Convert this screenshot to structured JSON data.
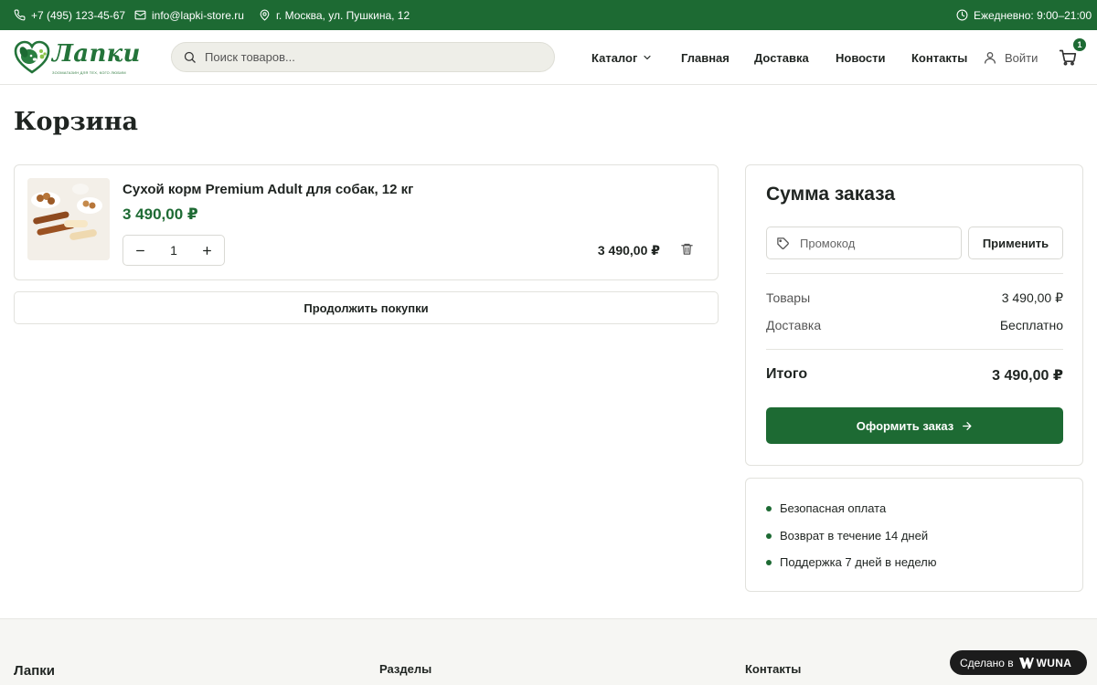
{
  "topbar": {
    "phone": "+7 (495) 123-45-67",
    "email": "info@lapki-store.ru",
    "address": "г. Москва, ул. Пушкина, 12",
    "hours": "Ежедневно: 9:00–21:00"
  },
  "header": {
    "logo_text": "Лапки",
    "logo_tagline": "ЗООМАГАЗИН ДЛЯ ТЕХ, КОГО ЛЮБИМ",
    "search_placeholder": "Поиск товаров...",
    "nav": [
      "Каталог",
      "Главная",
      "Доставка",
      "Новости",
      "Контакты"
    ],
    "login": "Войти",
    "cart_count": "1"
  },
  "page": {
    "title": "Корзина"
  },
  "cart": {
    "items": [
      {
        "name": "Сухой корм Premium Adult для собак, 12 кг",
        "price": "3 490,00 ₽",
        "quantity": "1",
        "line_total": "3 490,00 ₽"
      }
    ],
    "continue_label": "Продолжить покупки"
  },
  "summary": {
    "title": "Сумма заказа",
    "promo_placeholder": "Промокод",
    "apply_label": "Применить",
    "goods_label": "Товары",
    "goods_value": "3 490,00 ₽",
    "delivery_label": "Доставка",
    "delivery_value": "Бесплатно",
    "total_label": "Итого",
    "total_value": "3 490,00 ₽",
    "checkout_label": "Оформить заказ"
  },
  "benefits": [
    "Безопасная оплата",
    "Возврат в течение 14 дней",
    "Поддержка 7 дней в неделю"
  ],
  "footer": {
    "brand": "Лапки",
    "sections": "Разделы",
    "contacts": "Контакты"
  },
  "badge": {
    "made_label": "Сделано в",
    "made_brand": "WUNA"
  },
  "colors": {
    "brand_green": "#1d6a33",
    "text": "#1f2421",
    "border": "#e2e2dd"
  },
  "icons": [
    "phone-icon",
    "mail-icon",
    "location-icon",
    "clock-icon",
    "search-icon",
    "chevron-down-icon",
    "user-icon",
    "cart-icon",
    "minus-icon",
    "plus-icon",
    "trash-icon",
    "tag-icon",
    "arrow-right-icon"
  ]
}
